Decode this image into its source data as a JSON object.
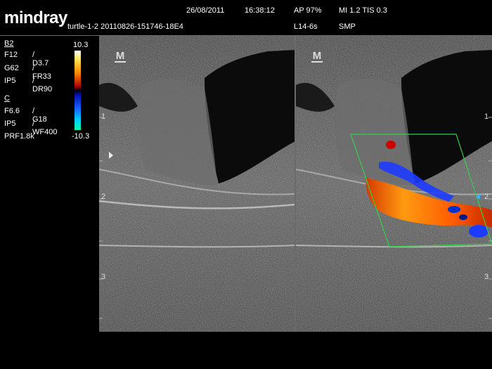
{
  "header": {
    "brand": "mindray",
    "patient_id": "turtle-1-2 20110826-151746-18E4",
    "date": "26/08/2011",
    "time": "16:38:12",
    "ap": "AP  97%",
    "mi_tis": "MI 1.2 TIS 0.3",
    "probe": "L14-6s",
    "preset": "SMP"
  },
  "bmode": {
    "section": "B2",
    "params": [
      {
        "a": "F12",
        "b": "/ D3.7"
      },
      {
        "a": "G62",
        "b": "/ FR33"
      },
      {
        "a": "IP5",
        "b": "/ DR90"
      }
    ]
  },
  "color": {
    "section": "C",
    "params": [
      {
        "a": "F6.6",
        "b": "/ G18"
      },
      {
        "a": "IP5",
        "b": "/ WF400"
      }
    ],
    "prf": "PRF1.8k"
  },
  "colorbar": {
    "top": "10.3",
    "bottom": "-10.3"
  },
  "views": {
    "marker": "M",
    "depth_labels": [
      "1",
      "2",
      "3"
    ]
  }
}
